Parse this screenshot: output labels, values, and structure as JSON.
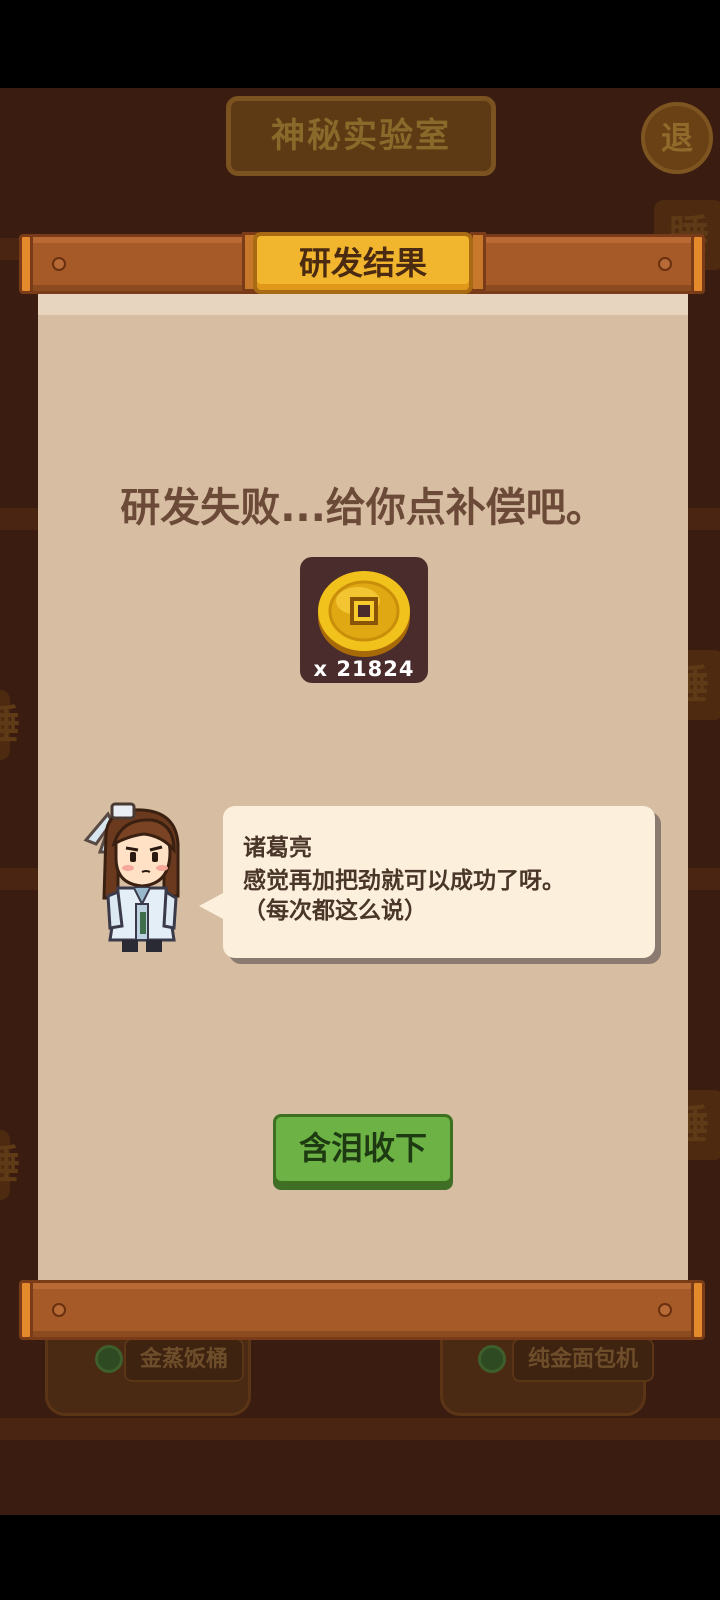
{
  "background": {
    "location_title": "神秘实验室",
    "exit_label": "退",
    "machines": [
      "金蒸饭桶",
      "纯金面包机"
    ],
    "side_tags": [
      "睡",
      "睡",
      "睡",
      "睡",
      "睡"
    ]
  },
  "dialog": {
    "title": "研发结果",
    "message": "研发失败...给你点补偿吧。",
    "reward": {
      "icon": "gold-coin-icon",
      "count_text": "x 21824"
    },
    "speaker": "诸葛亮",
    "quote": "感觉再加把劲就可以成功了呀。\n（每次都这么说）",
    "accept_button": "含泪收下"
  },
  "colors": {
    "panel": "#d7bda2",
    "title_tab": "#f2b52e",
    "button": "#6cb244",
    "wood": "#a55a28"
  }
}
